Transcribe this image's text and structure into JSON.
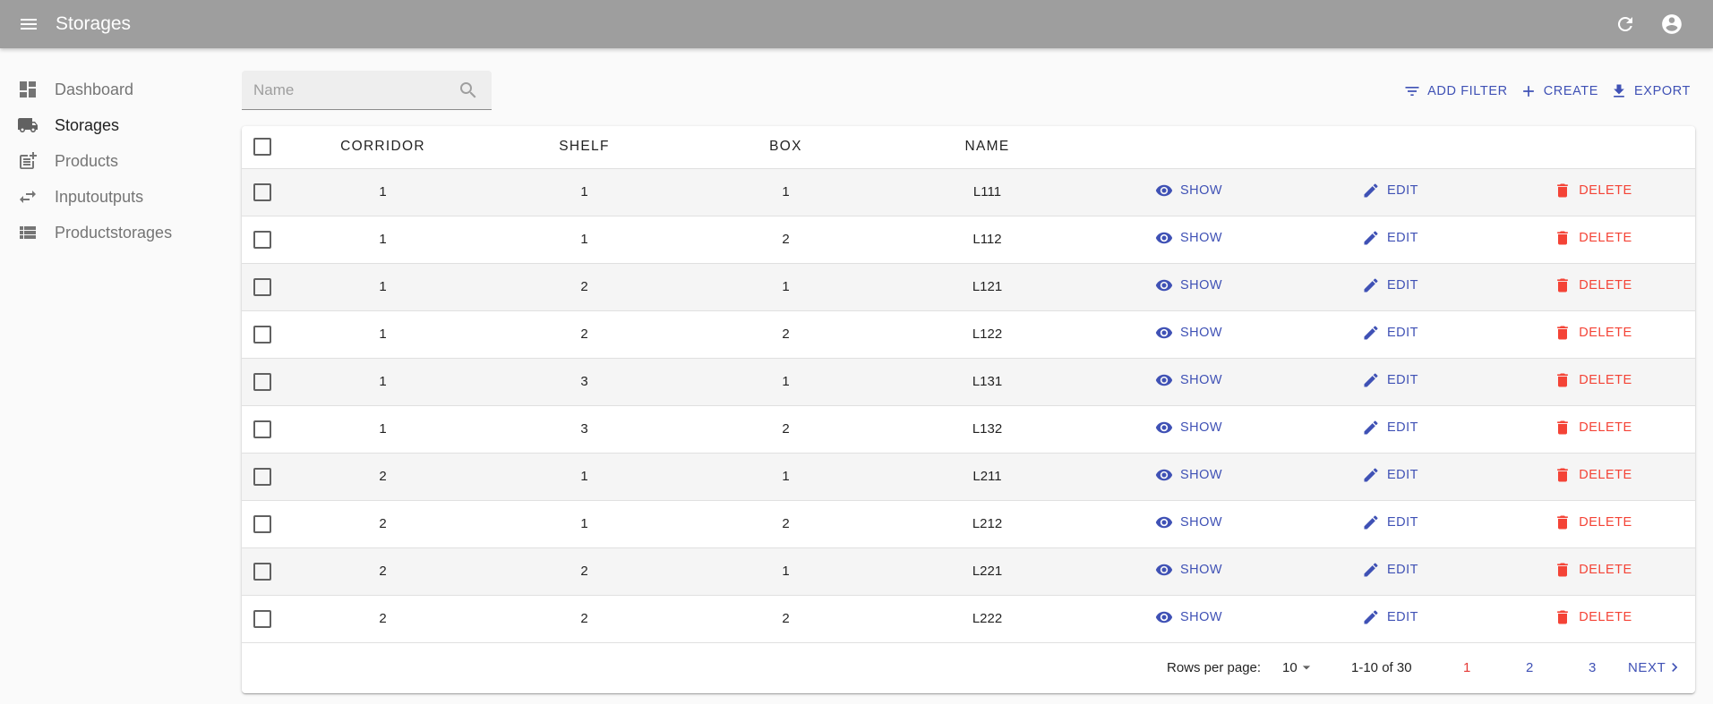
{
  "appbar": {
    "title": "Storages"
  },
  "sidebar": {
    "items": [
      {
        "label": "Dashboard",
        "icon": "dashboard-icon"
      },
      {
        "label": "Storages",
        "icon": "truck-icon"
      },
      {
        "label": "Products",
        "icon": "post-add-icon"
      },
      {
        "label": "Inputoutputs",
        "icon": "swap-horiz-icon"
      },
      {
        "label": "Productstorages",
        "icon": "view-list-icon"
      }
    ]
  },
  "search": {
    "placeholder": "Name"
  },
  "toolbar": {
    "add_filter": "ADD FILTER",
    "create": "CREATE",
    "export": "EXPORT"
  },
  "table": {
    "headers": {
      "corridor": "CORRIDOR",
      "shelf": "SHELF",
      "box": "BOX",
      "name": "NAME"
    },
    "actions": {
      "show": "SHOW",
      "edit": "EDIT",
      "delete": "DELETE"
    },
    "rows": [
      {
        "corridor": "1",
        "shelf": "1",
        "box": "1",
        "name": "L111"
      },
      {
        "corridor": "1",
        "shelf": "1",
        "box": "2",
        "name": "L112"
      },
      {
        "corridor": "1",
        "shelf": "2",
        "box": "1",
        "name": "L121"
      },
      {
        "corridor": "1",
        "shelf": "2",
        "box": "2",
        "name": "L122"
      },
      {
        "corridor": "1",
        "shelf": "3",
        "box": "1",
        "name": "L131"
      },
      {
        "corridor": "1",
        "shelf": "3",
        "box": "2",
        "name": "L132"
      },
      {
        "corridor": "2",
        "shelf": "1",
        "box": "1",
        "name": "L211"
      },
      {
        "corridor": "2",
        "shelf": "1",
        "box": "2",
        "name": "L212"
      },
      {
        "corridor": "2",
        "shelf": "2",
        "box": "1",
        "name": "L221"
      },
      {
        "corridor": "2",
        "shelf": "2",
        "box": "2",
        "name": "L222"
      }
    ]
  },
  "pagination": {
    "rows_per_page_label": "Rows per page:",
    "rows_per_page": "10",
    "range": "1-10 of 30",
    "pages": [
      "1",
      "2",
      "3"
    ],
    "current_page": "1",
    "next": "NEXT"
  },
  "colors": {
    "primary": "#3f51b5",
    "danger": "#f44336",
    "appbar": "#9e9e9e"
  }
}
